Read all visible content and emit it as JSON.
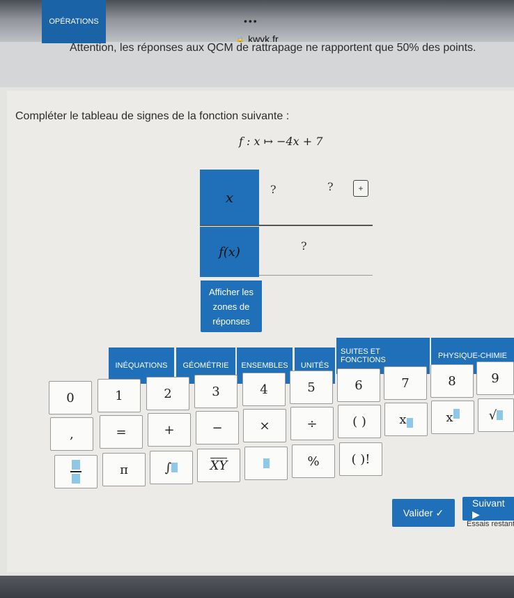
{
  "browser": {
    "dots": "•••",
    "url": "kwyk.fr"
  },
  "notice": "Attention, les réponses aux QCM de rattrapage ne rapportent que 50% des points.",
  "question": "Compléter le tableau de signes de la fonction suivante :",
  "formula": "f : x ↦ −4x + 7",
  "table": {
    "x_label": "x",
    "f_label": "f(x)",
    "q1": "?",
    "q2": "?",
    "q3": "?",
    "plus": "+"
  },
  "show_zones": "Afficher les zones de réponses",
  "tabs": [
    "OPÉRATIONS",
    "INÉQUATIONS",
    "GÉOMÉTRIE",
    "ENSEMBLES",
    "UNITÉS",
    "SUITES ET FONCTIONS",
    "PHYSIQUE-CHIMIE"
  ],
  "keys_row1": [
    "0",
    "1",
    "2",
    "3",
    "4",
    "5",
    "6",
    "7",
    "8",
    "9"
  ],
  "keys_row2": [
    ",",
    "=",
    "+",
    "−",
    "×",
    "÷",
    "( )",
    "x",
    "x",
    "√"
  ],
  "keys_row3": [
    "π",
    "∫",
    "XY",
    "%",
    "( )!"
  ],
  "valider": "Valider ✓",
  "suivant": "Suivant ▶",
  "essais": "Essais restants",
  "colors": {
    "accent": "#1f70b8"
  }
}
